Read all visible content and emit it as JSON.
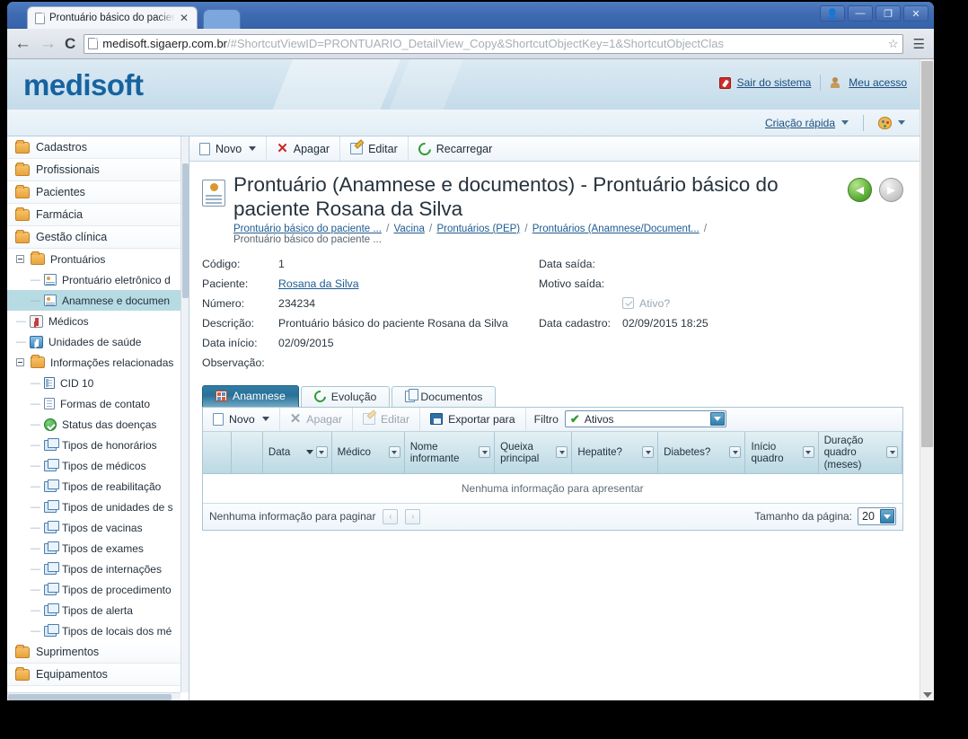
{
  "browser": {
    "tab_title": "Prontuário básico do paciente",
    "tab_close": "✕",
    "new_tab_label": "",
    "back_glyph": "←",
    "forward_glyph": "→",
    "reload_glyph": "C",
    "url_host": "medisoft.sigaerp.com.br",
    "url_path": "/#ShortcutViewID=PRONTUARIO_DetailView_Copy&ShortcutObjectKey=1&ShortcutObjectClas",
    "star_glyph": "☆",
    "menu_glyph": "☰",
    "window_controls": {
      "user": "👤",
      "minimize": "—",
      "restore": "❐",
      "close": "✕"
    }
  },
  "app": {
    "logo": "medisoft",
    "header_links": [
      {
        "label": "Sair do sistema",
        "icon": "exit-icon"
      },
      {
        "label": "Meu acesso",
        "icon": "user-icon"
      }
    ],
    "subbar": {
      "quick_create": "Criação rápida",
      "theme_icon": "palette-icon"
    }
  },
  "sidebar": {
    "items": [
      {
        "label": "Cadastros",
        "icon": "folder-icon",
        "level": 0
      },
      {
        "label": "Profissionais",
        "icon": "folder-icon",
        "level": 0
      },
      {
        "label": "Pacientes",
        "icon": "folder-icon",
        "level": 0
      },
      {
        "label": "Farmácia",
        "icon": "folder-icon",
        "level": 0
      },
      {
        "label": "Gestão clínica",
        "icon": "folder-icon",
        "level": 0
      },
      {
        "label": "Prontuários",
        "icon": "folder-icon",
        "level": 1,
        "expander": true
      },
      {
        "label": "Prontuário eletrônico d",
        "icon": "card-icon",
        "level": 2
      },
      {
        "label": "Anamnese e documen",
        "icon": "card-icon",
        "level": 2,
        "selected": true
      },
      {
        "label": "Médicos",
        "icon": "doctor-icon",
        "level": 1
      },
      {
        "label": "Unidades de saúde",
        "icon": "hospital-icon",
        "level": 1
      },
      {
        "label": "Informações relacionadas",
        "icon": "folder-icon",
        "level": 1,
        "expander": true
      },
      {
        "label": "CID 10",
        "icon": "cid-icon",
        "level": 2
      },
      {
        "label": "Formas de contato",
        "icon": "doc-icon",
        "level": 2
      },
      {
        "label": "Status das doenças",
        "icon": "check-icon",
        "level": 2
      },
      {
        "label": "Tipos de honorários",
        "icon": "stack-icon",
        "level": 2
      },
      {
        "label": "Tipos de médicos",
        "icon": "stack-icon",
        "level": 2
      },
      {
        "label": "Tipos de reabilitação",
        "icon": "stack-icon",
        "level": 2
      },
      {
        "label": "Tipos de unidades de s",
        "icon": "stack-icon",
        "level": 2
      },
      {
        "label": "Tipos de vacinas",
        "icon": "stack-icon",
        "level": 2
      },
      {
        "label": "Tipos de exames",
        "icon": "stack-icon",
        "level": 2
      },
      {
        "label": "Tipos de internações",
        "icon": "stack-icon",
        "level": 2
      },
      {
        "label": "Tipos de procedimento",
        "icon": "stack-icon",
        "level": 2
      },
      {
        "label": "Tipos de alerta",
        "icon": "stack-icon",
        "level": 2
      },
      {
        "label": "Tipos de locais dos mé",
        "icon": "stack-icon",
        "level": 2
      },
      {
        "label": "Suprimentos",
        "icon": "folder-icon",
        "level": 0
      },
      {
        "label": "Equipamentos",
        "icon": "folder-icon",
        "level": 0
      }
    ]
  },
  "toolbar": {
    "new_label": "Novo",
    "delete_label": "Apagar",
    "edit_label": "Editar",
    "reload_label": "Recarregar"
  },
  "record": {
    "title": "Prontuário (Anamnese e documentos) - Prontuário básico do paciente Rosana da Silva",
    "breadcrumb": [
      "Prontuário básico do paciente ...",
      "Vacina",
      "Prontuários (PEP)",
      "Prontuários (Anamnese/Document..."
    ],
    "breadcrumb_tail": "Prontuário básico do paciente ...",
    "nav_prev": "◄",
    "nav_next": "►",
    "fields_left": [
      {
        "label": "Código:",
        "value": "1"
      },
      {
        "label": "Paciente:",
        "value": "Rosana da Silva",
        "link": true
      },
      {
        "label": "Número:",
        "value": "234234"
      },
      {
        "label": "Descrição:",
        "value": "Prontuário básico do paciente Rosana da Silva"
      },
      {
        "label": "Data início:",
        "value": "02/09/2015"
      },
      {
        "label": "Observação:",
        "value": ""
      }
    ],
    "fields_right": [
      {
        "label": "Data saída:",
        "value": ""
      },
      {
        "label": "Motivo saída:",
        "value": ""
      }
    ],
    "active_checkbox": {
      "label": "Ativo?",
      "checked": true
    },
    "registered": {
      "label": "Data cadastro:",
      "value": "02/09/2015 18:25"
    }
  },
  "panel": {
    "tabs": [
      {
        "label": "Anamnese",
        "icon": "anamnese-icon",
        "active": true
      },
      {
        "label": "Evolução",
        "icon": "refresh-icon",
        "active": false
      },
      {
        "label": "Documentos",
        "icon": "documents-icon",
        "active": false
      }
    ],
    "grid_toolbar": {
      "new_label": "Novo",
      "delete_label": "Apagar",
      "edit_label": "Editar",
      "export_label": "Exportar para",
      "filter_label": "Filtro",
      "filter_value": "Ativos"
    },
    "columns": [
      {
        "label": "Data",
        "sorted": true
      },
      {
        "label": "Médico"
      },
      {
        "label": "Nome informante"
      },
      {
        "label": "Queixa principal"
      },
      {
        "label": "Hepatite?"
      },
      {
        "label": "Diabetes?"
      },
      {
        "label": "Início quadro"
      },
      {
        "label": "Duração quadro (meses)"
      }
    ],
    "empty_message": "Nenhuma informação para apresentar",
    "footer": {
      "paging_message": "Nenhuma informação para paginar",
      "prev_glyph": "‹",
      "next_glyph": "›",
      "pagesize_label": "Tamanho da página:",
      "pagesize_value": "20"
    }
  },
  "colors": {
    "brand_blue": "#16639f",
    "link_blue": "#1d5b91",
    "tab_active": "#2a7097",
    "selection": "#b7dbe3",
    "grid_header": "#cfe4eb"
  }
}
